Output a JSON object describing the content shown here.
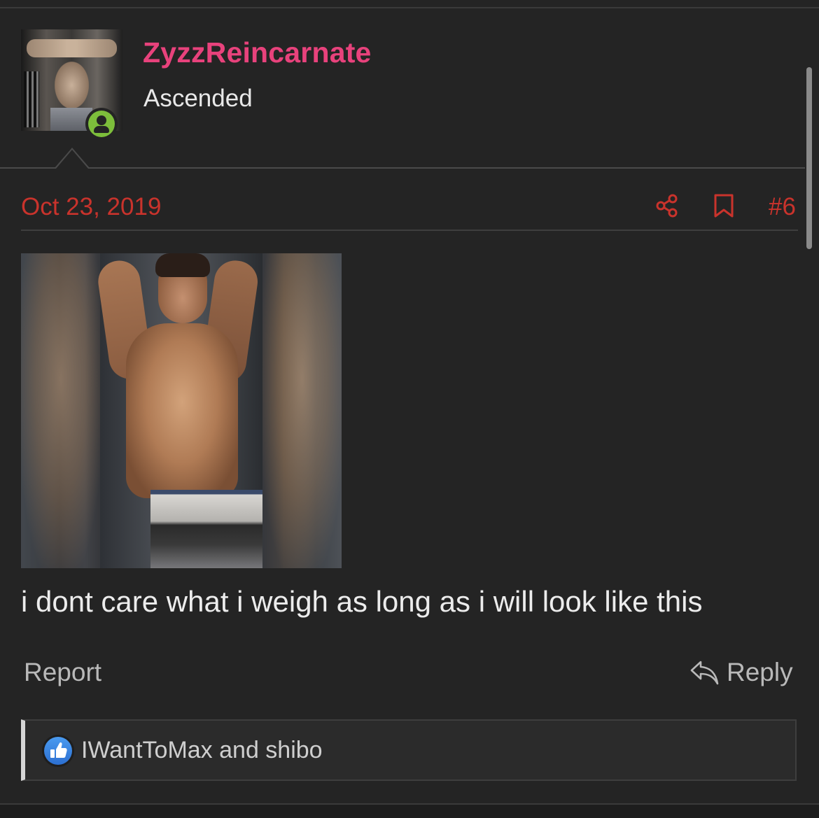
{
  "post": {
    "username": "ZyzzReincarnate",
    "user_title": "Ascended",
    "date": "Oct 23, 2019",
    "post_number": "#6",
    "message": "i dont care what i weigh as long as i will look like this"
  },
  "actions": {
    "report_label": "Report",
    "reply_label": "Reply"
  },
  "reactions": {
    "text": "IWantToMax and shibo"
  },
  "icons": {
    "share": "share-icon",
    "bookmark": "bookmark-icon",
    "reply": "reply-icon",
    "like": "thumbs-up-icon",
    "online": "online-status-icon"
  },
  "colors": {
    "username": "#e8427c",
    "date_accent": "#c9332c",
    "online_badge": "#7dbe3b",
    "like_blue": "#3b87e3",
    "background": "#242424"
  }
}
